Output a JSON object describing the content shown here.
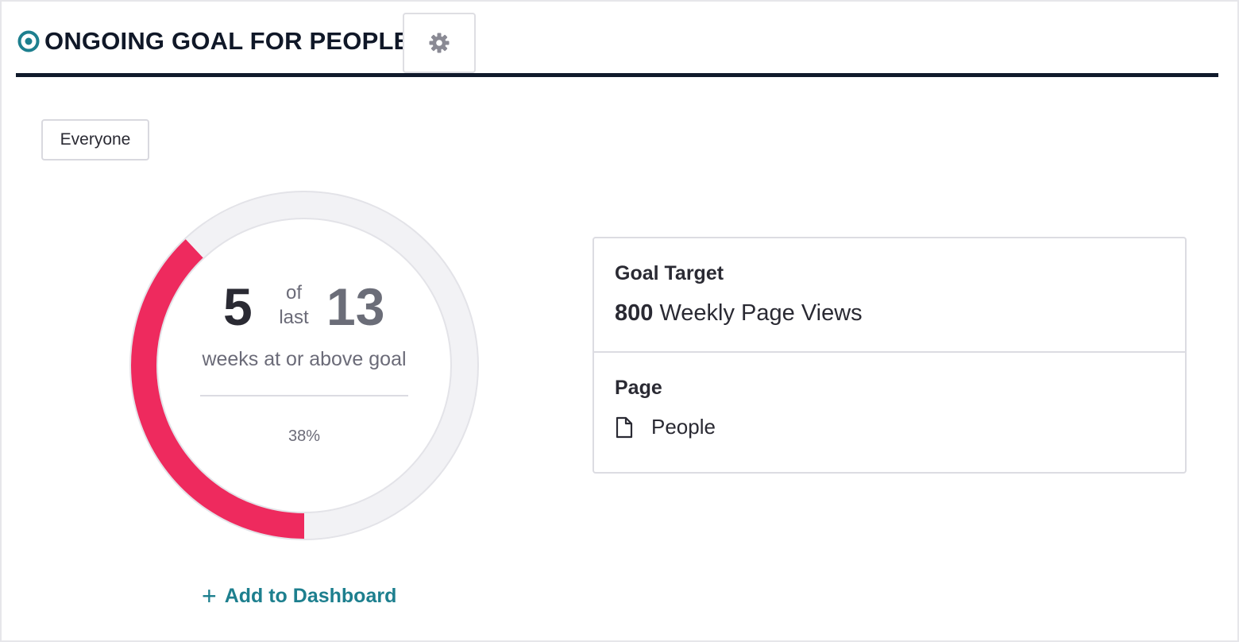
{
  "header": {
    "title": "ONGOING GOAL FOR PEOPLE",
    "icon": "target-circle-icon",
    "accent_color": "#1d7f8e",
    "settings_icon": "gear-icon"
  },
  "segment": {
    "label": "Everyone"
  },
  "progress": {
    "count": "5",
    "of_label": "of",
    "last_label": "last",
    "total": "13",
    "caption": "weeks at or above goal",
    "percent_label": "38%",
    "fraction": 0.38,
    "progress_color": "#ee2a5e",
    "track_color": "#f2f2f5"
  },
  "actions": {
    "add_dashboard_plus": "+",
    "add_dashboard_label": "Add to Dashboard"
  },
  "card": {
    "target_label": "Goal Target",
    "target_value": "800",
    "target_metric": "Weekly Page Views",
    "page_label": "Page",
    "page_icon": "document-icon",
    "page_name": "People"
  }
}
